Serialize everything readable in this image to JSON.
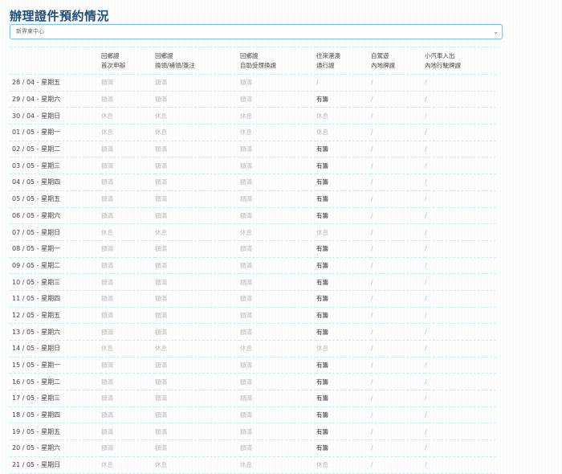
{
  "title": "辦理證件預約情況",
  "office_select": {
    "value": "新界東中心",
    "icon": "chevron-down-icon"
  },
  "columns": [
    {
      "line1": "",
      "line2": ""
    },
    {
      "line1": "回鄉證",
      "line2": "首次申辦"
    },
    {
      "line1": "回鄉證",
      "line2": "換領/補領/簽注"
    },
    {
      "line1": "回鄉證",
      "line2": "自助受理換證"
    },
    {
      "line1": "往來港澳",
      "line2": "通行證"
    },
    {
      "line1": "自駕遊",
      "line2": "內地牌證"
    },
    {
      "line1": "小汽車入出",
      "line2": "內地行駛牌證"
    }
  ],
  "rows": [
    [
      "28 / 04 - 星期五",
      "額滿",
      "額滿",
      "額滿",
      "/",
      "/",
      "/"
    ],
    [
      "29 / 04 - 星期六",
      "額滿",
      "額滿",
      "額滿",
      "有籌",
      "/",
      "/"
    ],
    [
      "30 / 04 - 星期日",
      "休息",
      "休息",
      "休息",
      "休息",
      "/",
      "/"
    ],
    [
      "01 / 05 - 星期一",
      "休息",
      "休息",
      "休息",
      "休息",
      "/",
      "/"
    ],
    [
      "02 / 05 - 星期二",
      "額滿",
      "額滿",
      "額滿",
      "有籌",
      "/",
      "/"
    ],
    [
      "03 / 05 - 星期三",
      "額滿",
      "額滿",
      "額滿",
      "有籌",
      "/",
      "/"
    ],
    [
      "04 / 05 - 星期四",
      "額滿",
      "額滿",
      "額滿",
      "有籌",
      "/",
      "/"
    ],
    [
      "05 / 05 - 星期五",
      "額滿",
      "額滿",
      "額滿",
      "有籌",
      "/",
      "/"
    ],
    [
      "06 / 05 - 星期六",
      "額滿",
      "額滿",
      "額滿",
      "有籌",
      "/",
      "/"
    ],
    [
      "07 / 05 - 星期日",
      "休息",
      "休息",
      "休息",
      "休息",
      "/",
      "/"
    ],
    [
      "08 / 05 - 星期一",
      "額滿",
      "額滿",
      "額滿",
      "有籌",
      "/",
      "/"
    ],
    [
      "09 / 05 - 星期二",
      "額滿",
      "額滿",
      "額滿",
      "有籌",
      "/",
      "/"
    ],
    [
      "10 / 05 - 星期三",
      "額滿",
      "額滿",
      "額滿",
      "有籌",
      "/",
      "/"
    ],
    [
      "11 / 05 - 星期四",
      "額滿",
      "額滿",
      "額滿",
      "有籌",
      "/",
      "/"
    ],
    [
      "12 / 05 - 星期五",
      "額滿",
      "額滿",
      "額滿",
      "有籌",
      "/",
      "/"
    ],
    [
      "13 / 05 - 星期六",
      "額滿",
      "額滿",
      "額滿",
      "有籌",
      "/",
      "/"
    ],
    [
      "14 / 05 - 星期日",
      "休息",
      "休息",
      "休息",
      "休息",
      "/",
      "/"
    ],
    [
      "15 / 05 - 星期一",
      "額滿",
      "額滿",
      "額滿",
      "有籌",
      "/",
      "/"
    ],
    [
      "16 / 05 - 星期二",
      "額滿",
      "額滿",
      "額滿",
      "有籌",
      "/",
      "/"
    ],
    [
      "17 / 05 - 星期三",
      "額滿",
      "額滿",
      "額滿",
      "有籌",
      "/",
      "/"
    ],
    [
      "18 / 05 - 星期四",
      "額滿",
      "額滿",
      "額滿",
      "有籌",
      "/",
      "/"
    ],
    [
      "19 / 05 - 星期五",
      "額滿",
      "額滿",
      "額滿",
      "有籌",
      "/",
      "/"
    ],
    [
      "20 / 05 - 星期六",
      "額滿",
      "額滿",
      "額滿",
      "有籌",
      "/",
      "/"
    ],
    [
      "21 / 05 - 星期日",
      "休息",
      "休息",
      "休息",
      "休息",
      "/",
      "/"
    ]
  ]
}
